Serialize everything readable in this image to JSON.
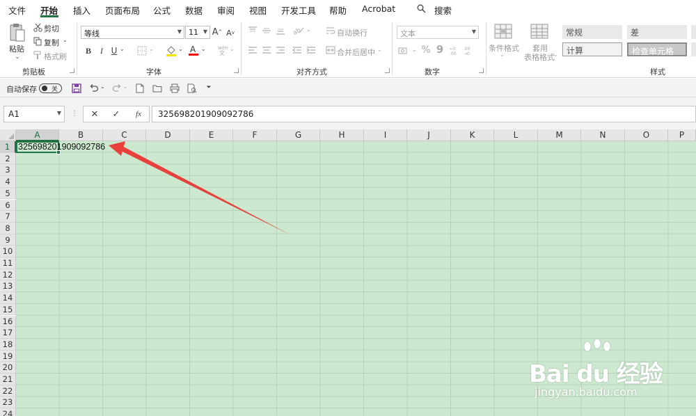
{
  "menu": {
    "tabs": [
      "文件",
      "开始",
      "插入",
      "页面布局",
      "公式",
      "数据",
      "审阅",
      "视图",
      "开发工具",
      "帮助",
      "Acrobat"
    ],
    "active_tab": "开始",
    "search_label": "搜索",
    "accent_color": "#217346"
  },
  "ribbon": {
    "clipboard": {
      "paste_label": "粘贴",
      "cut_label": "剪切",
      "copy_label": "复制",
      "format_painter_label": "格式刷",
      "group_label": "剪贴板"
    },
    "font": {
      "font_name": "等线",
      "font_size": "11",
      "bold": "B",
      "italic": "I",
      "underline": "U",
      "grow_font": "A",
      "shrink_font": "A",
      "group_label": "字体",
      "font_color": "#ff0000"
    },
    "alignment": {
      "wrap_text_label": "自动换行",
      "merge_center_label": "合并后居中",
      "group_label": "对齐方式"
    },
    "number": {
      "format_value": "文本",
      "percent": "%",
      "comma": "9",
      "group_label": "数字"
    },
    "styles": {
      "conditional_format_label": "条件格式",
      "table_format_label_1": "套用",
      "table_format_label_2": "表格格式",
      "cell_styles": [
        "常规",
        "差",
        "计算",
        "检查单元格"
      ],
      "group_label": "样式"
    }
  },
  "qat": {
    "autosave_label": "自动保存",
    "autosave_state": "关"
  },
  "formula_bar": {
    "name_box": "A1",
    "cancel": "✕",
    "enter": "✓",
    "fx": "fx",
    "content": "325698201909092786"
  },
  "sheet": {
    "columns": [
      "A",
      "B",
      "C",
      "D",
      "E",
      "F",
      "G",
      "H",
      "I",
      "J",
      "K",
      "L",
      "M",
      "N",
      "O",
      "P"
    ],
    "rows": [
      "1",
      "2",
      "3",
      "4",
      "5",
      "6",
      "7",
      "8",
      "9",
      "10",
      "11",
      "12",
      "13",
      "14",
      "15",
      "16",
      "17",
      "18",
      "19",
      "20",
      "21",
      "22",
      "23",
      "24"
    ],
    "cell_a1": "325698201909092786",
    "sheet_bg_color": "#cce8cf"
  },
  "annotation": {
    "arrow_color": "#e8413c"
  },
  "watermark": {
    "logo_text": "Bai du 经验",
    "url": "jingyan.baidu.com"
  }
}
